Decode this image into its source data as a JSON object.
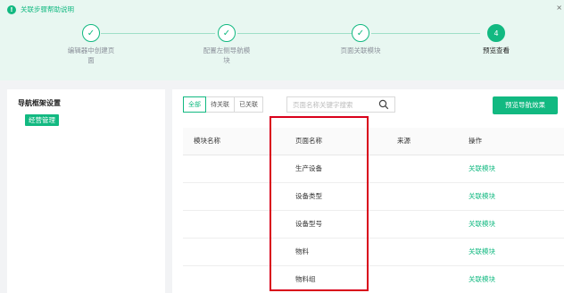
{
  "help": {
    "icon": "!",
    "text": "关联步骤帮助说明",
    "close": "×"
  },
  "steps": [
    {
      "mark": "✓",
      "label_line1": "编辑器中创建页",
      "label_line2": "面"
    },
    {
      "mark": "✓",
      "label_line1": "配置左侧导航模",
      "label_line2": "块"
    },
    {
      "mark": "✓",
      "label_line1": "页面关联模块",
      "label_line2": ""
    },
    {
      "mark": "4",
      "label_line1": "预览查看",
      "label_line2": ""
    }
  ],
  "left_panel": {
    "title": "导航框架设置",
    "tree_item": "经营管理"
  },
  "filters": [
    "全部",
    "待关联",
    "已关联"
  ],
  "search": {
    "placeholder": "页面名称关键字搜索"
  },
  "preview_button": "预览导航效果",
  "table": {
    "headers": [
      "模块名称",
      "页面名称",
      "来源",
      "操作"
    ],
    "rows": [
      {
        "module": "",
        "page": "生产设备",
        "source": "",
        "action": "关联模块"
      },
      {
        "module": "",
        "page": "设备类型",
        "source": "",
        "action": "关联模块"
      },
      {
        "module": "",
        "page": "设备型号",
        "source": "",
        "action": "关联模块"
      },
      {
        "module": "",
        "page": "物料",
        "source": "",
        "action": "关联模块"
      },
      {
        "module": "",
        "page": "物料组",
        "source": "",
        "action": "关联模块"
      }
    ]
  },
  "colors": {
    "accent": "#12b981",
    "highlight": "#d9001b",
    "steps_bg": "#e8f7f1"
  }
}
